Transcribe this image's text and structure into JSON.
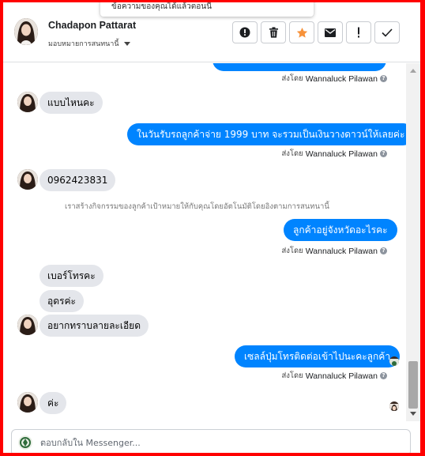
{
  "header": {
    "contact_name": "Chadapon Pattarat",
    "assign_label": "มอบหมายการสนทนานี้",
    "tooltip_text": "ข้อความของคุณได้แล้วตอนนี้",
    "buttons": [
      {
        "name": "alert-circle-button",
        "icon": "alert-circle-icon"
      },
      {
        "name": "trash-button",
        "icon": "trash-icon"
      },
      {
        "name": "star-button",
        "icon": "star-icon"
      },
      {
        "name": "envelope-button",
        "icon": "envelope-icon"
      },
      {
        "name": "exclamation-button",
        "icon": "exclamation-icon"
      },
      {
        "name": "check-button",
        "icon": "check-icon"
      }
    ]
  },
  "messages": {
    "sent_by_label": "ส่งโดย",
    "agent_name": "Wannaluck Pilawan",
    "m1_in": "แบบไหนคะ",
    "m2_out": "ในวันรับรถลูกค้าจ่าย 1999 บาท จะรวมเป็นเงินวางดาวน์ให้เลยค่ะ",
    "m3_in": "0962423831",
    "system_note": "เราสร้างกิจกรรมของลูกค้าเป้าหมายให้กับคุณโดยอัตโนมัติโดยอิงตามการสนทนานี้",
    "m4_out": "ลูกค้าอยู่จังหวัดอะไรคะ",
    "m5_in": "เบอร์โทรคะ",
    "m6_in": "อุดรค่ะ",
    "m7_in": "อยากทราบลายละเอียด",
    "m8_out": "เซลล์ปุ่มโทรติดต่อเข้าไปนะคะลูกค้า",
    "m9_in": "ค่ะ"
  },
  "composer": {
    "placeholder": "ตอบกลับใน Messenger..."
  },
  "colors": {
    "outgoing_bubble": "#0084ff",
    "incoming_bubble": "#e4e6eb",
    "star_accent": "#f7923a",
    "frame": "#ff0000"
  }
}
